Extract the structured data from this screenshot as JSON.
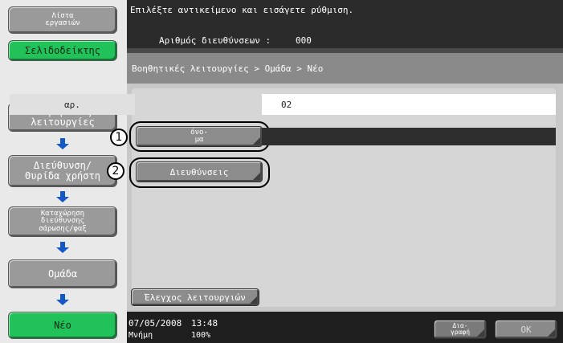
{
  "sidebar": {
    "job_list": "Λίστα\nεργασιών",
    "bookmark": "Σελιδοδείκτης",
    "steps": [
      {
        "label": "Βοηθητικές\nλειτουργίες"
      },
      {
        "label": "Διεύθυνση/\nΘυρίδα χρήστη"
      },
      {
        "label": "Καταχώρηση\nδιεύθυνσης\nσάρωσης/φαξ"
      },
      {
        "label": "Ομάδα"
      },
      {
        "label": "Νέο"
      }
    ]
  },
  "header": {
    "message": "Επιλέξτε αντικείμενο και εισάγετε ρύθμιση.",
    "count_label": "Αριθμός διευθύνσεων :",
    "count_value": "000"
  },
  "breadcrumb": "Βοηθητικές λειτουργίες > Ομάδα > Νέο",
  "form": {
    "number_label": "αρ.",
    "number_value": "02",
    "name_button": "όνο-\nμα",
    "addresses_button": "Διευθύνσεις",
    "check_button": "Έλεγχος λειτουργιών"
  },
  "callouts": [
    "1",
    "2"
  ],
  "footer": {
    "date": "07/05/2008",
    "time": "13:48",
    "memory_label": "Μνήμη",
    "memory_value": "100%",
    "delete_button": "Δια-\nγραφή",
    "ok_button": "OK"
  }
}
